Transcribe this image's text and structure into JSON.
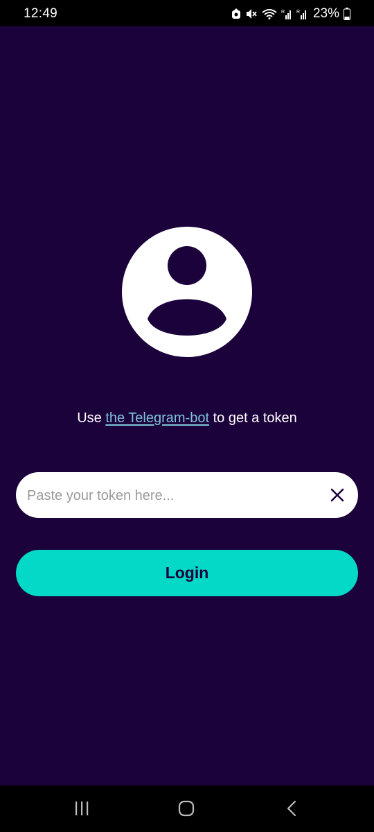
{
  "status_bar": {
    "time": "12:49",
    "battery": "23%",
    "icons": [
      "app-notification-icon",
      "mute-icon",
      "wifi-icon",
      "signal-icon",
      "signal-icon",
      "battery-icon"
    ]
  },
  "login": {
    "avatar_icon": "user-avatar-icon",
    "helper_prefix": "Use ",
    "helper_link": "the Telegram-bot",
    "helper_suffix": " to get a token",
    "token_placeholder": "Paste your token here...",
    "token_value": "",
    "clear_icon": "close-icon",
    "login_label": "Login"
  },
  "nav_bar": {
    "items": [
      "recent-apps-icon",
      "home-icon",
      "back-icon"
    ]
  },
  "colors": {
    "background": "#1c023b",
    "accent": "#03d9c6",
    "link": "#7dc4d8"
  }
}
